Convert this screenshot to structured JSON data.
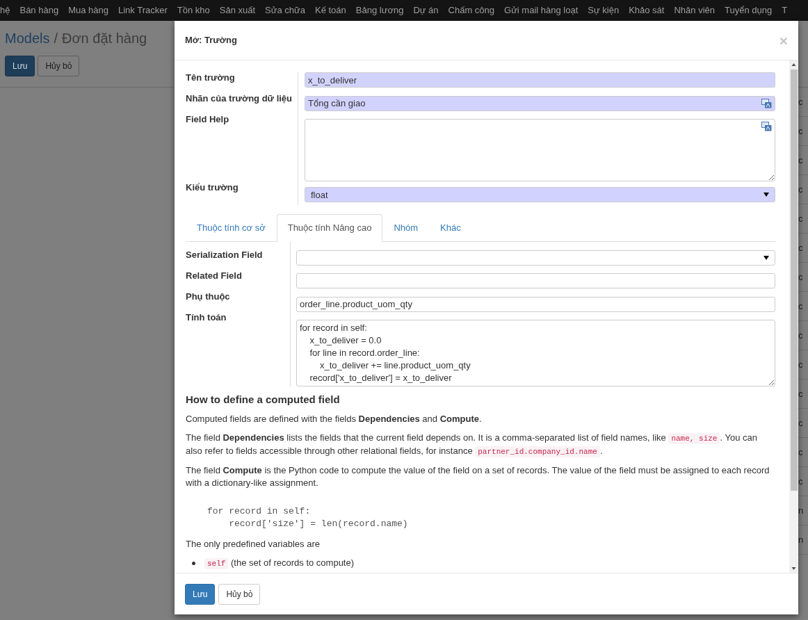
{
  "top_menu": [
    "hệ",
    "Bán hàng",
    "Mua hàng",
    "Link Tracker",
    "Tồn kho",
    "Sản xuất",
    "Sửa chữa",
    "Kế toán",
    "Bảng lương",
    "Dự án",
    "Chấm công",
    "Gửi mail hàng loạt",
    "Sự kiện",
    "Khảo sát",
    "Nhân viên",
    "Tuyển dụng",
    "T"
  ],
  "breadcrumb": [
    {
      "label": "Models",
      "link": true
    },
    {
      "label": "Đơn đặt hàng",
      "link": false
    }
  ],
  "breadcrumb_separator": "/",
  "page_buttons": [
    {
      "label": "Lưu",
      "primary": true
    },
    {
      "label": "Hủy bỏ",
      "primary": false
    }
  ],
  "background_rows": [
    "c",
    "c",
    "c",
    "c",
    "c",
    "c",
    "c",
    "c",
    "c",
    "c",
    "c",
    "c",
    "c",
    "c",
    "n",
    "n"
  ],
  "dialog": {
    "title": "Mở: Trường",
    "close": "×",
    "fields": [
      {
        "label": "Tên trường",
        "kind": "input",
        "value": "x_to_deliver",
        "required": true,
        "translatable": false
      },
      {
        "label": "Nhãn của trường dữ liệu",
        "kind": "input",
        "value": "Tổng cần giao",
        "required": true,
        "translatable": true
      },
      {
        "label": "Field Help",
        "kind": "textarea",
        "required": false,
        "translatable": true
      },
      {
        "label": "Kiểu trường",
        "kind": "select",
        "value": "float",
        "required": true,
        "translatable": false
      }
    ],
    "tabs": [
      {
        "label": "Thuộc tính cơ sở",
        "selected": false
      },
      {
        "label": "Thuộc tính Nâng cao",
        "selected": true
      },
      {
        "label": "Nhóm",
        "selected": false
      },
      {
        "label": "Khác",
        "selected": false
      }
    ],
    "tab_fields": [
      {
        "label": "Serialization Field",
        "kind": "select"
      },
      {
        "label": "Related Field",
        "kind": "input"
      },
      {
        "label": "Phụ thuộc",
        "kind": "input",
        "value": "order_line.product_uom_qty"
      },
      {
        "label": "Tính toán",
        "kind": "textarea",
        "value": "for record in self:\n    x_to_deliver = 0.0\n    for line in record.order_line:\n        x_to_deliver += line.product_uom_qty\n    record['x_to_deliver'] = x_to_deliver"
      }
    ],
    "help": [
      {
        "kind": "heading",
        "text": "How to define a computed field"
      },
      {
        "kind": "paragraph",
        "parts": [
          {
            "kind": "text",
            "text": "Computed fields are defined with the fields **Dependencies** and **Compute**."
          }
        ]
      },
      {
        "kind": "paragraph",
        "parts": [
          {
            "kind": "text",
            "text": "The field **Dependencies** lists the fields that the current field depends on. It is a comma-separated list of field names, like "
          },
          {
            "kind": "code",
            "text": "name, size"
          },
          {
            "kind": "text",
            "text": ". You can also refer to fields accessible through other relational fields, for instance "
          },
          {
            "kind": "code",
            "text": "partner_id.company_id.name"
          },
          {
            "kind": "text",
            "text": "."
          }
        ]
      },
      {
        "kind": "paragraph",
        "parts": [
          {
            "kind": "text",
            "text": "The field **Compute** is the Python code to compute the value of the field on a set of records. The value of the field must be assigned to each record with a dictionary-like assignment."
          }
        ]
      },
      {
        "kind": "code",
        "text": "for record in self:\n    record['size'] = len(record.name)"
      },
      {
        "kind": "paragraph",
        "parts": [
          {
            "kind": "text",
            "text": "The only predefined variables are"
          }
        ]
      },
      {
        "kind": "bullet",
        "parts": [
          {
            "kind": "code",
            "text": "self"
          },
          {
            "kind": "text",
            "text": " (the set of records to compute)"
          }
        ]
      }
    ],
    "buttons": [
      {
        "label": "Lưu",
        "primary": true
      },
      {
        "label": "Hủy bỏ",
        "primary": false
      }
    ]
  }
}
